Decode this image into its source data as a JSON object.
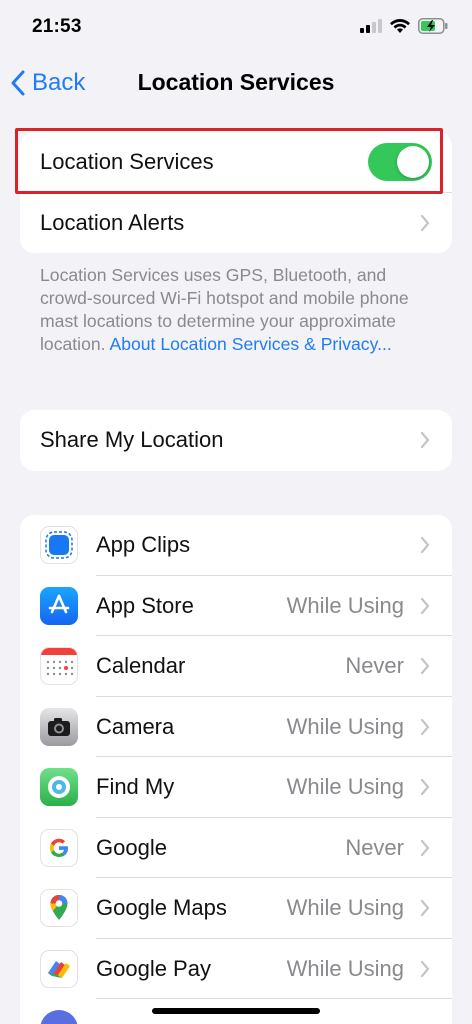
{
  "status": {
    "time": "21:53"
  },
  "nav": {
    "back_label": "Back",
    "title": "Location Services"
  },
  "main_group": {
    "location_services_label": "Location Services",
    "location_services_on": true,
    "location_alerts_label": "Location Alerts"
  },
  "footnote": {
    "text": "Location Services uses GPS, Bluetooth, and crowd-sourced Wi-Fi hotspot and mobile phone mast locations to determine your approximate location. ",
    "link": "About Location Services & Privacy..."
  },
  "share": {
    "label": "Share My Location"
  },
  "apps": [
    {
      "name": "App Clips",
      "value": "",
      "icon": "app-clips-icon"
    },
    {
      "name": "App Store",
      "value": "While Using",
      "icon": "app-store-icon"
    },
    {
      "name": "Calendar",
      "value": "Never",
      "icon": "calendar-icon"
    },
    {
      "name": "Camera",
      "value": "While Using",
      "icon": "camera-icon"
    },
    {
      "name": "Find My",
      "value": "While Using",
      "icon": "find-my-icon"
    },
    {
      "name": "Google",
      "value": "Never",
      "icon": "google-icon"
    },
    {
      "name": "Google Maps",
      "value": "While Using",
      "icon": "google-maps-icon"
    },
    {
      "name": "Google Pay",
      "value": "While Using",
      "icon": "google-pay-icon"
    }
  ],
  "colors": {
    "accent": "#1f7cf6",
    "toggle_on": "#34c759",
    "highlight": "#d8232a",
    "background": "#f2f2f7"
  }
}
